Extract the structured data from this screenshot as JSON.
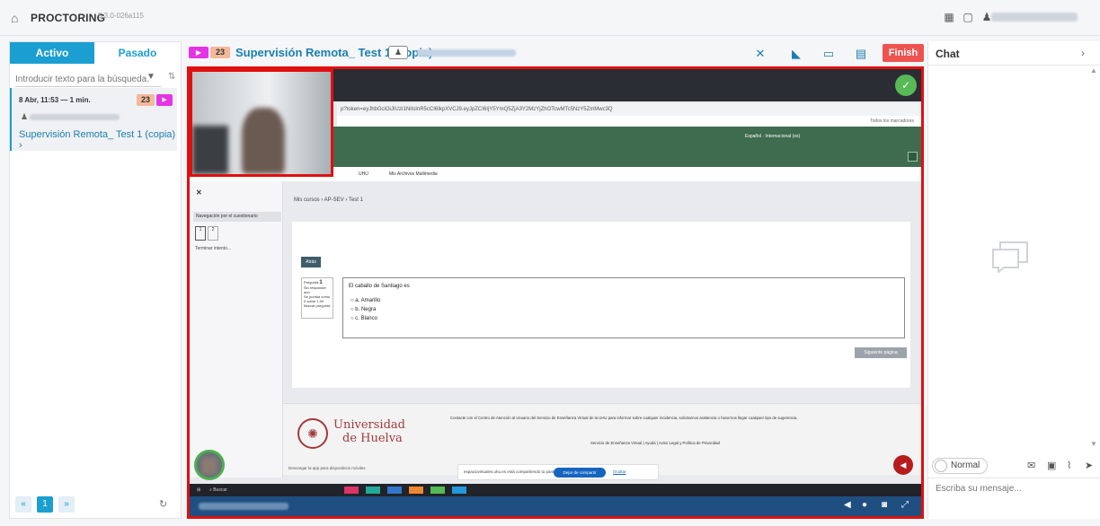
{
  "topbar": {
    "title": "PROCTORING",
    "version": "5.3.0-026a115"
  },
  "left": {
    "tabs": [
      {
        "label": "Activo"
      },
      {
        "label": "Pasado"
      }
    ],
    "search_placeholder": "Introducir texto para la búsqueda.",
    "session": {
      "date": "8 Abr, 11:53 — 1 min.",
      "count": "23",
      "exam": "Supervisión Remota_ Test 1 (copia)",
      "arrow": "›"
    },
    "pager": {
      "prev": "«",
      "current": "1",
      "next": "»"
    }
  },
  "header": {
    "count": "23",
    "title": "Supervisión Remota_ Test 1 (copia)",
    "finish": "Finish"
  },
  "screen": {
    "addressbar": "p?token=eyJhbGciOiJIUzI1NiIsInR5cCI6IkpXVCJ9.eyJpZCI6IjY5YmQ5ZjA3Y2MzYjZhOTcwMTc5NzY5ZmMwc3Q",
    "bookmarks_all": "Todos los marcadores",
    "site_controls": "Español · Internacional (es)",
    "nav_uhu": "UHU",
    "nav_media": "Mis Archivos Multimedia",
    "quiz_nav_title": "Navegación por el cuestionario",
    "q1": "1",
    "q2": "2",
    "terminar": "Terminar intento...",
    "breadcrumb": "Mis cursos › AP-SEV › Test 1",
    "atras": "Atrás",
    "qinfo_label": "Pregunta",
    "qinfo_num": "1",
    "qinfo_state": "Sin responder aún",
    "qinfo_points": "Se puntúa como 0 sobre 1,00",
    "qinfo_flag": "Marcar pregunta",
    "question": "El caballo de Santiago es",
    "options": [
      "a. Amarillo",
      "b. Negra",
      "c. Blanco"
    ],
    "siguiente": "Siguiente página",
    "uni_line1": "Universidad",
    "uni_line2": "de Huelva",
    "contacte": "Contacte con el Centro de Atención al Usuario del Servicio de Enseñanza Virtual de la UHU para informar sobre cualquier incidencia, solicitarnos asistencia o hacernos llegar cualquier tipo de sugerencia.",
    "servicio": "Servicio de Enseñanza Virtual | Ayuda | Aviso Legal y Política de Privacidad",
    "descarga": "Descargar la app para dispositivos móviles",
    "share_text": "espaciovirtuales.uhu.es está compartiendo tu pantalla.",
    "share_stop": "Dejar de compartir",
    "share_hide": "Ocultar",
    "buscar": "Buscar"
  },
  "chat": {
    "title": "Chat",
    "mode": "Normal",
    "placeholder": "Escriba su mensaje..."
  },
  "colors": {
    "accent": "#1a9fd0",
    "finish": "#ef5350",
    "frame": "#e01010",
    "magenta": "#e633e6"
  }
}
